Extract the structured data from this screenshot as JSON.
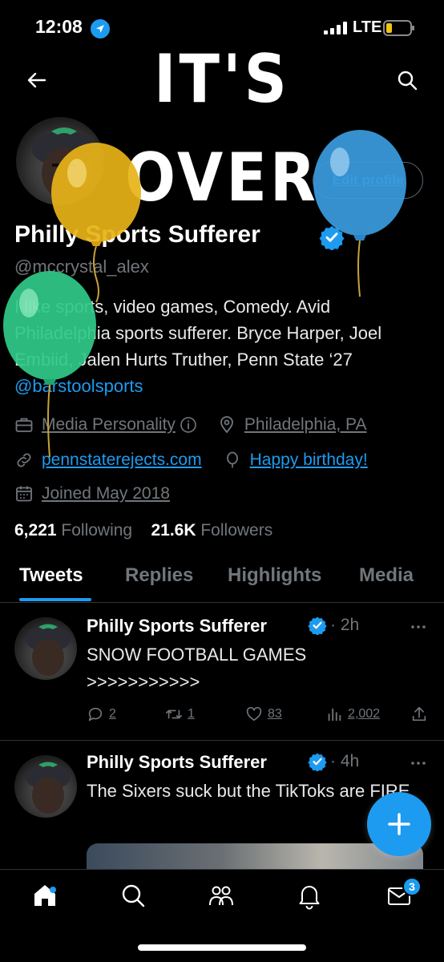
{
  "status_bar": {
    "time": "12:08",
    "network": "LTE"
  },
  "header": {
    "banner_text": "IT'S OVER"
  },
  "profile": {
    "edit_label": "Edit profile",
    "display_name": "Philly Sports Sufferer",
    "handle": "@mccrystal_alex",
    "bio_text": "I like sports, video games, Comedy. Avid Philadelphia sports sufferer. Bryce Harper, Joel Embiid, Jalen Hurts Truther, Penn State ‘27 ",
    "bio_mention": "@barstoolsports",
    "category": "Media Personality",
    "location": "Philadelphia, PA",
    "website": "pennstaterejects.com",
    "birthday": "Happy birthday!",
    "joined": "Joined May 2018",
    "following_count": "6,221",
    "following_label": "Following",
    "followers_count": "21.6K",
    "followers_label": "Followers"
  },
  "tabs": [
    {
      "label": "Tweets"
    },
    {
      "label": "Replies"
    },
    {
      "label": "Highlights"
    },
    {
      "label": "Media"
    }
  ],
  "tweets": [
    {
      "name": "Philly Sports Sufferer",
      "time": "· 2h",
      "text": "SNOW FOOTBALL GAMES >>>>>>>>>>>",
      "replies": "2",
      "retweets": "1",
      "likes": "83",
      "views": "2,002"
    },
    {
      "name": "Philly Sports Sufferer",
      "time": "· 4h",
      "text": "The Sixers suck but the TikToks are FIRE"
    }
  ],
  "nav": {
    "messages_badge": "3"
  },
  "colors": {
    "accent": "#1d9bf0",
    "background": "#000000",
    "muted": "#71767b"
  },
  "icons": [
    "location-arrow-icon",
    "signal-icon",
    "battery-icon",
    "back-arrow-icon",
    "search-icon",
    "verified-icon",
    "briefcase-icon",
    "info-icon",
    "location-pin-icon",
    "link-icon",
    "balloon-icon",
    "calendar-icon",
    "more-icon",
    "reply-icon",
    "retweet-icon",
    "like-icon",
    "views-icon",
    "share-icon",
    "plus-icon",
    "home-icon",
    "communities-icon",
    "bell-icon",
    "mail-icon"
  ]
}
